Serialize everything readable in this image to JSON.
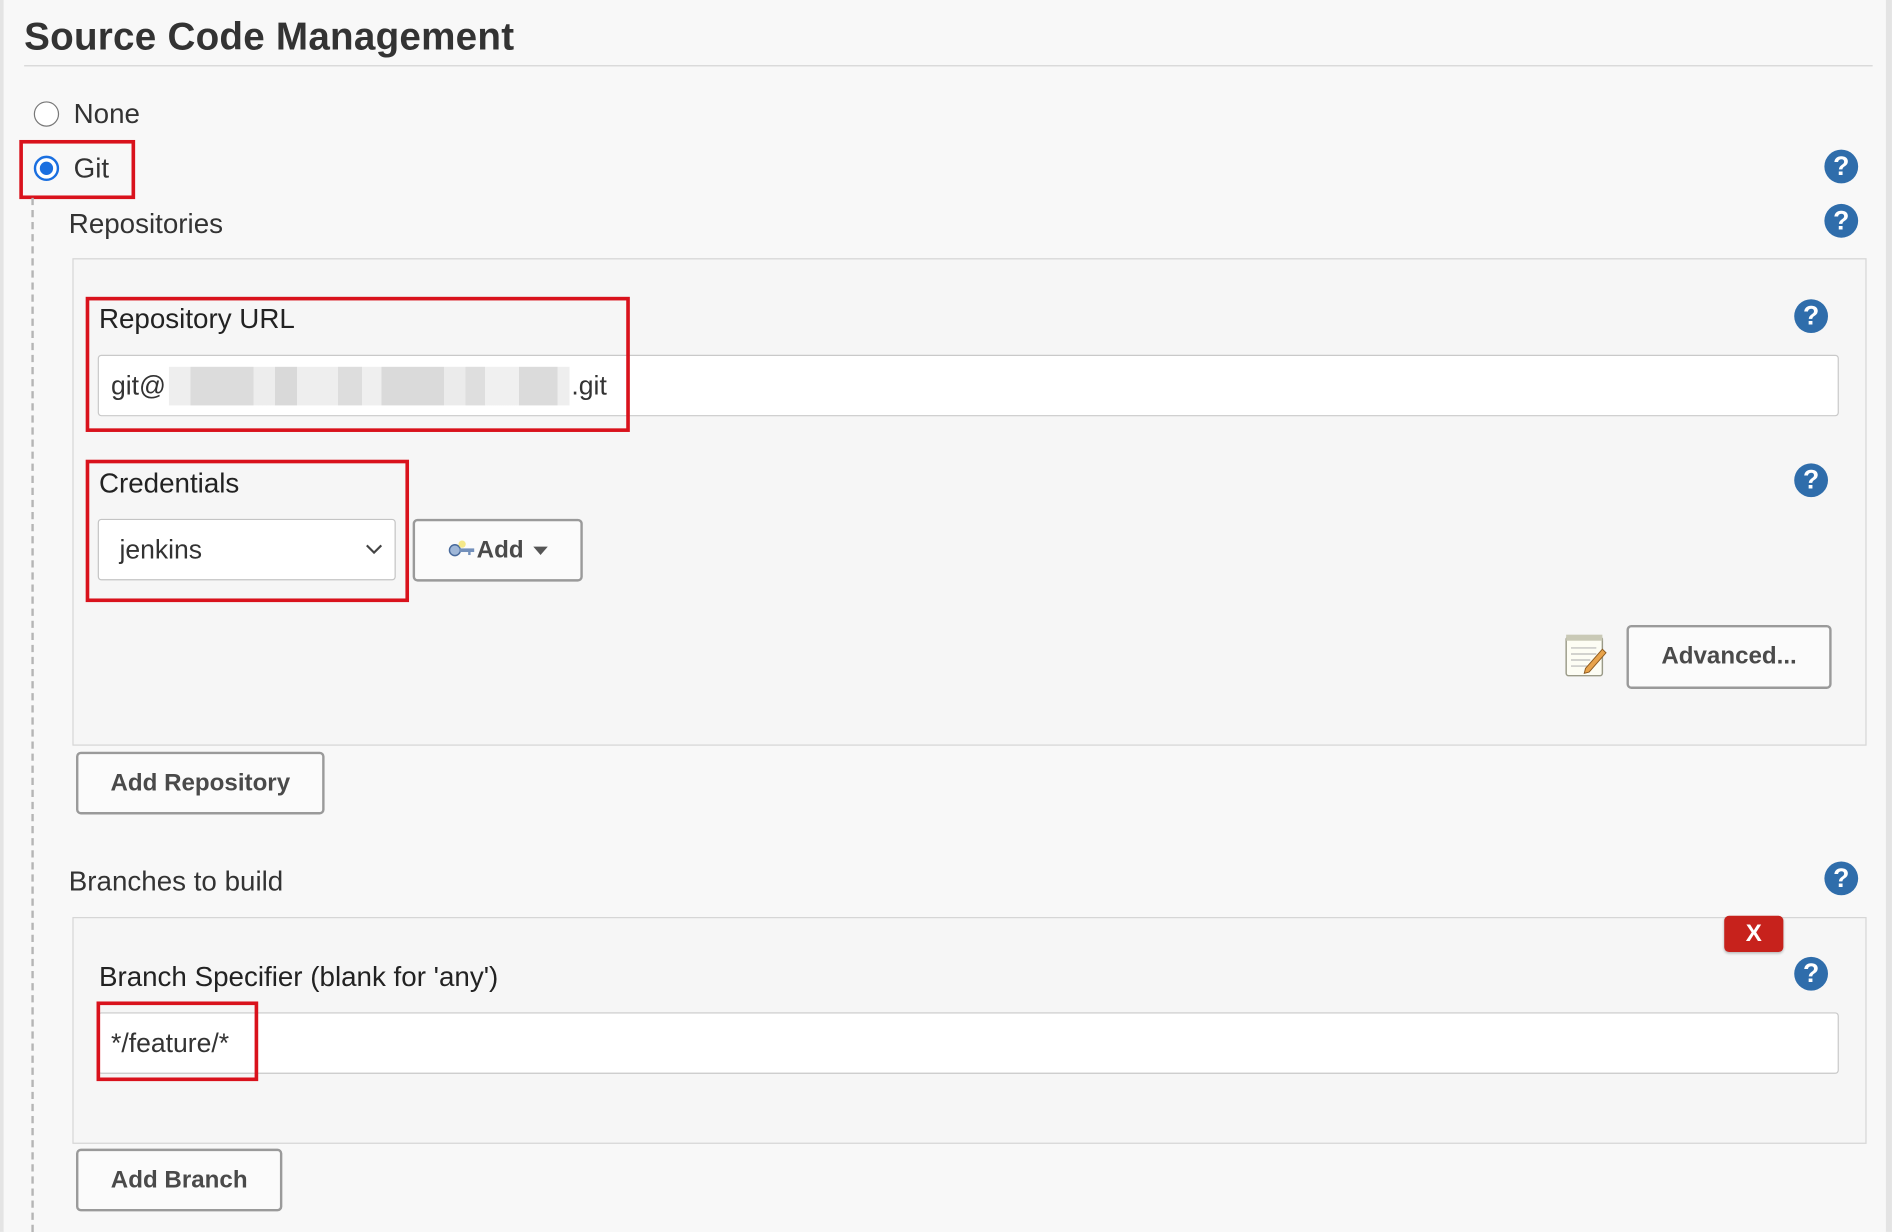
{
  "section": {
    "title": "Source Code Management"
  },
  "scm_options": [
    {
      "label": "None",
      "selected": false
    },
    {
      "label": "Git",
      "selected": true
    }
  ],
  "git": {
    "repositories_label": "Repositories",
    "repository_url": {
      "label": "Repository URL",
      "value_prefix": "git@",
      "value_suffix": ".git",
      "value_obscured": true
    },
    "credentials": {
      "label": "Credentials",
      "selected": "jenkins",
      "add_label": "Add",
      "add_icon": "key-icon"
    },
    "advanced_label": "Advanced...",
    "advanced_icon": "notepad-icon",
    "add_repository_label": "Add Repository",
    "branches_label": "Branches to build",
    "branch_specifier": {
      "label": "Branch Specifier (blank for 'any')",
      "value": "*/feature/*"
    },
    "delete_label": "X",
    "add_branch_label": "Add Branch"
  },
  "help_icon_text": "?",
  "colors": {
    "accent_radio": "#1a6fe0",
    "help_icon": "#2f6dab",
    "highlight": "#d9121c",
    "delete_button": "#c7221c"
  }
}
